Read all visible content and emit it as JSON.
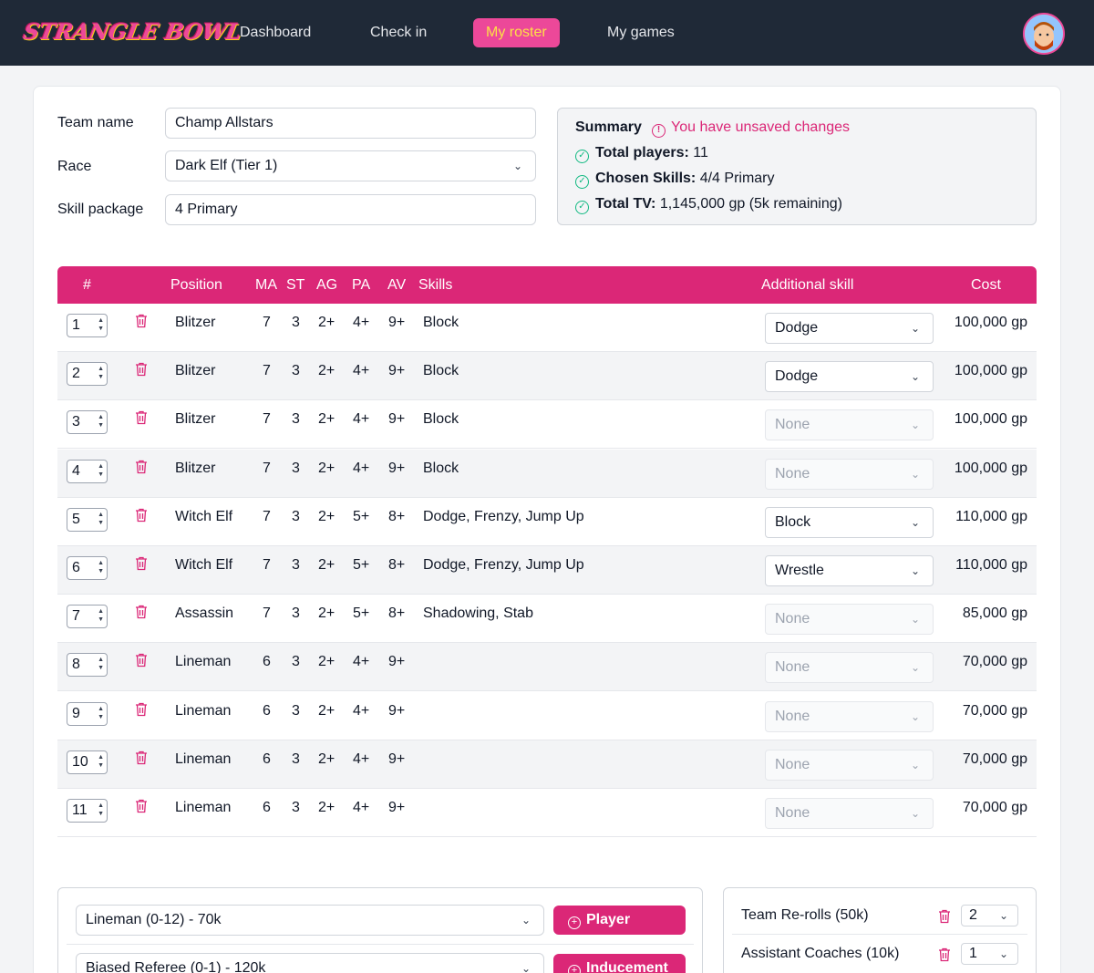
{
  "app": {
    "logo": "STRANGLE BOWL",
    "nav": [
      {
        "label": "Dashboard",
        "active": false
      },
      {
        "label": "Check in",
        "active": false
      },
      {
        "label": "My roster",
        "active": true
      },
      {
        "label": "My games",
        "active": false
      }
    ]
  },
  "form": {
    "team_name_label": "Team name",
    "team_name_value": "Champ Allstars",
    "race_label": "Race",
    "race_value": "Dark Elf (Tier 1)",
    "skill_package_label": "Skill package",
    "skill_package_value": "4 Primary"
  },
  "summary": {
    "title": "Summary",
    "warning": "You have unsaved changes",
    "players_label": "Total players:",
    "players_value": "11",
    "skills_label": "Chosen Skills:",
    "skills_value": "4/4 Primary",
    "tv_label": "Total TV:",
    "tv_value": "1,145,000 gp (5k remaining)"
  },
  "table": {
    "headers": {
      "num": "#",
      "position": "Position",
      "ma": "MA",
      "st": "ST",
      "ag": "AG",
      "pa": "PA",
      "av": "AV",
      "skills": "Skills",
      "additional": "Additional skill",
      "cost": "Cost"
    },
    "rows": [
      {
        "num": "1",
        "position": "Blitzer",
        "ma": "7",
        "st": "3",
        "ag": "2+",
        "pa": "4+",
        "av": "9+",
        "skills": "Block",
        "additional": "Dodge",
        "enabled": true,
        "cost": "100,000 gp"
      },
      {
        "num": "2",
        "position": "Blitzer",
        "ma": "7",
        "st": "3",
        "ag": "2+",
        "pa": "4+",
        "av": "9+",
        "skills": "Block",
        "additional": "Dodge",
        "enabled": true,
        "cost": "100,000 gp"
      },
      {
        "num": "3",
        "position": "Blitzer",
        "ma": "7",
        "st": "3",
        "ag": "2+",
        "pa": "4+",
        "av": "9+",
        "skills": "Block",
        "additional": "None",
        "enabled": false,
        "cost": "100,000 gp"
      },
      {
        "num": "4",
        "position": "Blitzer",
        "ma": "7",
        "st": "3",
        "ag": "2+",
        "pa": "4+",
        "av": "9+",
        "skills": "Block",
        "additional": "None",
        "enabled": false,
        "cost": "100,000 gp"
      },
      {
        "num": "5",
        "position": "Witch Elf",
        "ma": "7",
        "st": "3",
        "ag": "2+",
        "pa": "5+",
        "av": "8+",
        "skills": "Dodge, Frenzy, Jump Up",
        "additional": "Block",
        "enabled": true,
        "cost": "110,000 gp"
      },
      {
        "num": "6",
        "position": "Witch Elf",
        "ma": "7",
        "st": "3",
        "ag": "2+",
        "pa": "5+",
        "av": "8+",
        "skills": "Dodge, Frenzy, Jump Up",
        "additional": "Wrestle",
        "enabled": true,
        "cost": "110,000 gp"
      },
      {
        "num": "7",
        "position": "Assassin",
        "ma": "7",
        "st": "3",
        "ag": "2+",
        "pa": "5+",
        "av": "8+",
        "skills": "Shadowing, Stab",
        "additional": "None",
        "enabled": false,
        "cost": "85,000 gp"
      },
      {
        "num": "8",
        "position": "Lineman",
        "ma": "6",
        "st": "3",
        "ag": "2+",
        "pa": "4+",
        "av": "9+",
        "skills": "",
        "additional": "None",
        "enabled": false,
        "cost": "70,000 gp"
      },
      {
        "num": "9",
        "position": "Lineman",
        "ma": "6",
        "st": "3",
        "ag": "2+",
        "pa": "4+",
        "av": "9+",
        "skills": "",
        "additional": "None",
        "enabled": false,
        "cost": "70,000 gp"
      },
      {
        "num": "10",
        "position": "Lineman",
        "ma": "6",
        "st": "3",
        "ag": "2+",
        "pa": "4+",
        "av": "9+",
        "skills": "",
        "additional": "None",
        "enabled": false,
        "cost": "70,000 gp"
      },
      {
        "num": "11",
        "position": "Lineman",
        "ma": "6",
        "st": "3",
        "ag": "2+",
        "pa": "4+",
        "av": "9+",
        "skills": "",
        "additional": "None",
        "enabled": false,
        "cost": "70,000 gp"
      }
    ]
  },
  "add": {
    "player_select": "Lineman (0-12) - 70k",
    "player_button": "Player",
    "inducement_select": "Biased Referee (0-1) - 120k",
    "inducement_button": "Inducement"
  },
  "extras": {
    "rerolls_label": "Team Re-rolls (50k)",
    "rerolls_value": "2",
    "coaches_label": "Assistant Coaches (10k)",
    "coaches_value": "1"
  },
  "colors": {
    "accent": "#db2777",
    "nav_bg": "#1f2937",
    "active_text": "#fde047",
    "success": "#10b981"
  }
}
